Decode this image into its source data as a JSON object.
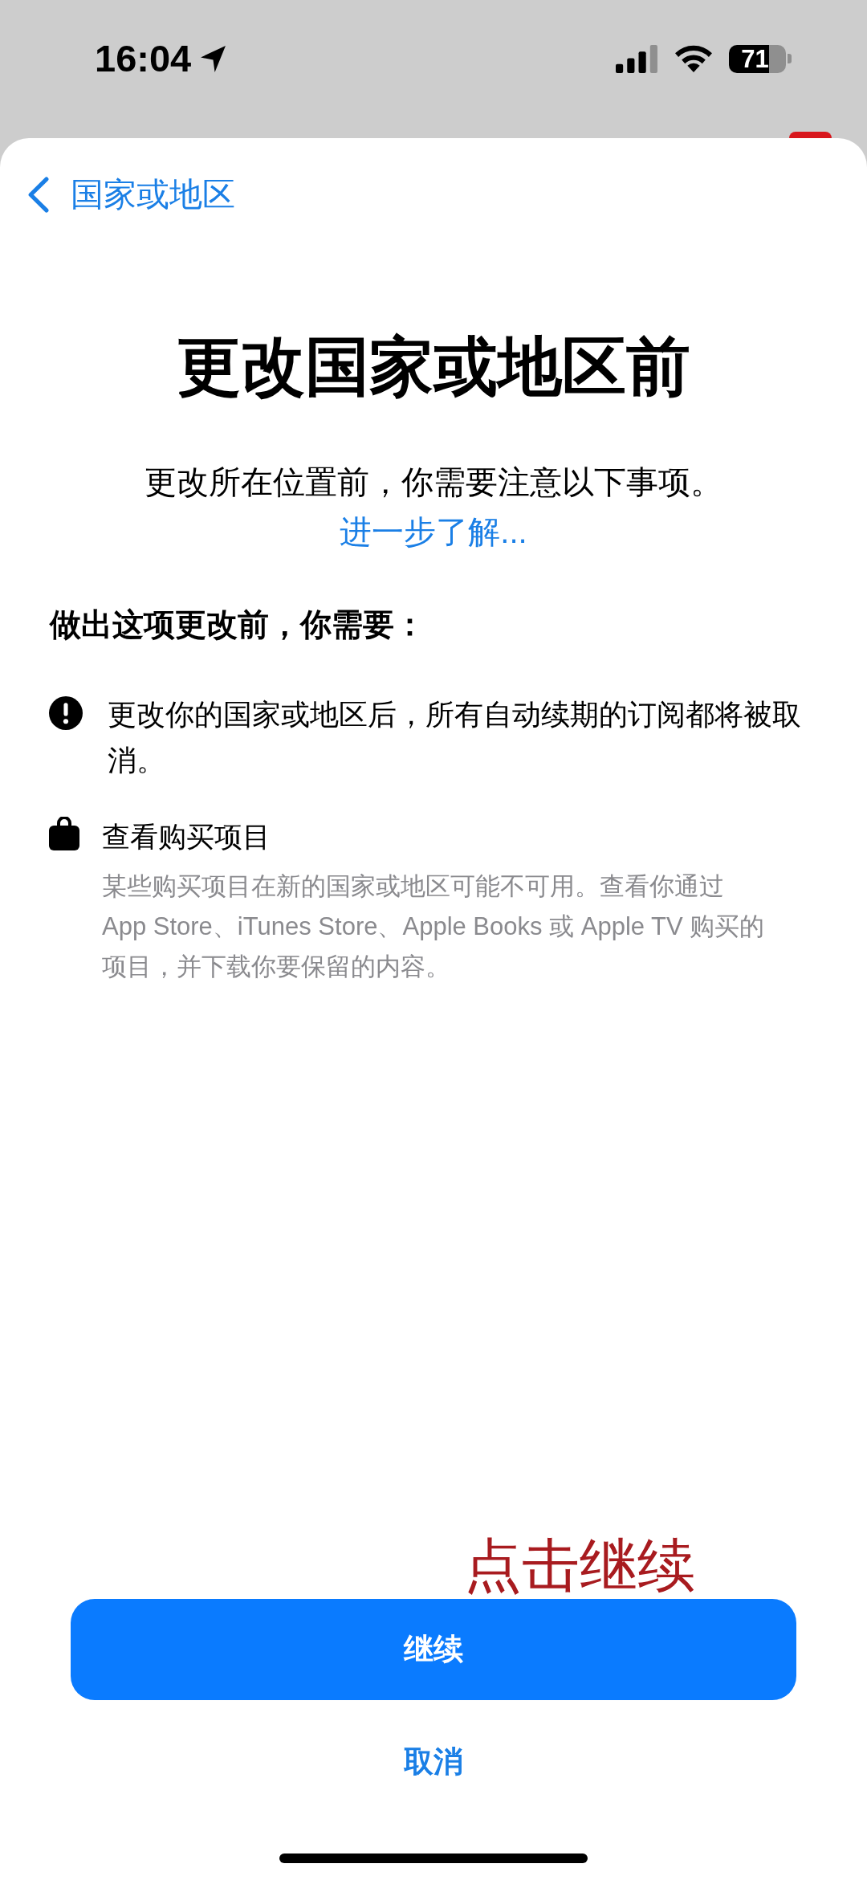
{
  "status_bar": {
    "time": "16:04",
    "battery": "71"
  },
  "nav": {
    "back_label": "国家或地区"
  },
  "title": "更改国家或地区前",
  "intro": {
    "text": "更改所在位置前，你需要注意以下事项。",
    "link": "进一步了解..."
  },
  "section_heading": "做出这项更改前，你需要：",
  "items": [
    {
      "kind": "warning",
      "text": "更改你的国家或地区后，所有自动续期的订阅都将被取消。"
    },
    {
      "kind": "purchases",
      "title": "查看购买项目",
      "description": "某些购买项目在新的国家或地区可能不可用。查看你通过 App Store、iTunes Store、Apple Books 或 Apple TV 购买的项目，并下载你要保留的内容。"
    }
  ],
  "buttons": {
    "primary": "继续",
    "secondary": "取消"
  },
  "annotation": "点击继续"
}
